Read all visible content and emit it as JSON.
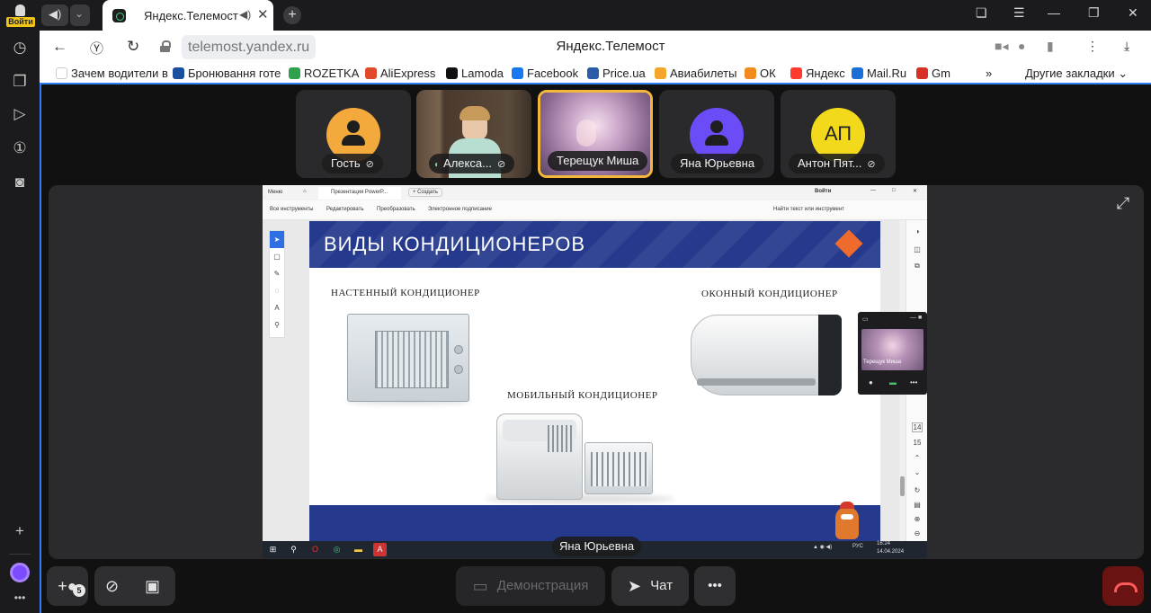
{
  "sidebar": {
    "login_label": "Войти"
  },
  "browser": {
    "tab_title": "Яндекс.Телемост",
    "url": "telemost.yandex.ru",
    "page_title": "Яндекс.Телемост",
    "bookmarks": [
      {
        "label": "Зачем водители в",
        "color": "#ffffff"
      },
      {
        "label": "Бронювання готе",
        "color": "#1a4fa0"
      },
      {
        "label": "ROZETKA",
        "color": "#2fa14d"
      },
      {
        "label": "AliExpress",
        "color": "#e04a2b"
      },
      {
        "label": "Lamoda",
        "color": "#111111"
      },
      {
        "label": "Facebook",
        "color": "#1877f2"
      },
      {
        "label": "Price.ua",
        "color": "#2a5caa"
      },
      {
        "label": "Авиабилеты",
        "color": "#f4a62a"
      },
      {
        "label": "ОК",
        "color": "#f28b1e"
      },
      {
        "label": "Яндекс",
        "color": "#ff3b30"
      },
      {
        "label": "Mail.Ru",
        "color": "#1a6fd8"
      },
      {
        "label": "Gm",
        "color": "#d93025"
      }
    ],
    "bookmarks_more": "»",
    "other_bookmarks": "Другие закладки"
  },
  "participants": [
    {
      "name": "Гость",
      "type": "avatar",
      "avatar_color": "#f3a93b",
      "muted": true
    },
    {
      "name": "Алекса...",
      "type": "video",
      "muted": true
    },
    {
      "name": "Терещук Миша",
      "type": "video",
      "muted": false,
      "active": true
    },
    {
      "name": "Яна Юрьевна",
      "type": "avatar",
      "avatar_color": "#6b4cf6",
      "muted": false
    },
    {
      "name": "Антон Пят...",
      "type": "initials",
      "initials": "АП",
      "avatar_color": "#f2d91b",
      "muted": true
    }
  ],
  "shared_screen": {
    "speaker": "Яна Юрьевна",
    "window_tabs": [
      "Меню",
      "Презентация PowerP...",
      "+ Создать"
    ],
    "window_login": "Войти",
    "toolbar": [
      "Все инструменты",
      "Редактировать",
      "Преобразовать",
      "Электронное подписание"
    ],
    "search_placeholder": "Найти текст или инструмент",
    "slide": {
      "title": "ВИДЫ КОНДИЦИОНЕРОВ",
      "caption_wall": "НАСТЕННЫЙ КОНДИЦИОНЕР",
      "caption_window": "ОКОННЫЙ КОНДИЦИОНЕР",
      "caption_mobile": "МОБИЛЬНЫЙ КОНДИЦИОНЕР"
    },
    "page_numbers": [
      "14",
      "15"
    ],
    "mini_name": "Терещук Миша",
    "taskbar_time": "16:24",
    "taskbar_date": "14.04.2024",
    "taskbar_lang": "РУС"
  },
  "controls": {
    "participants_count": "5",
    "share_label": "Демонстрация",
    "chat_label": "Чат",
    "more_label": "•••"
  }
}
